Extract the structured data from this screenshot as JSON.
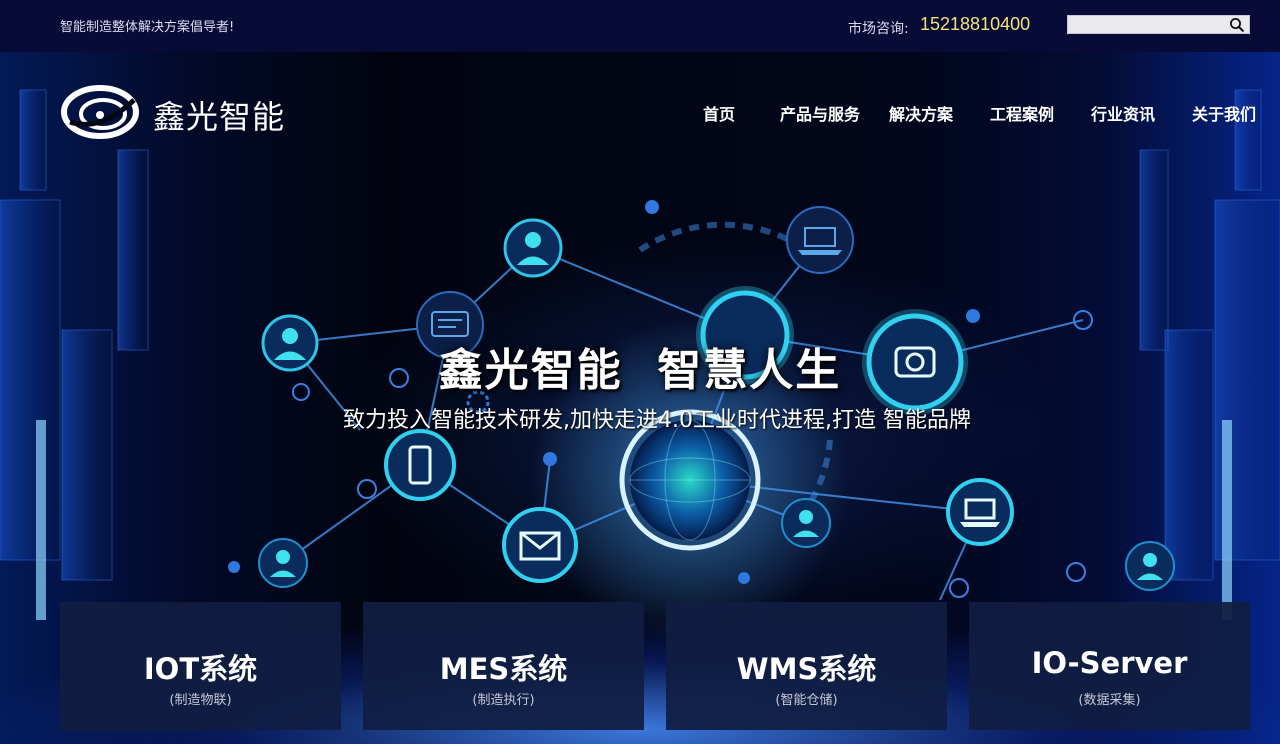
{
  "topbar": {
    "slogan": "智能制造整体解决方案倡导者!",
    "hotline_label": "市场咨询:",
    "hotline_number": "15218810400",
    "search_placeholder": ""
  },
  "header": {
    "brand": "鑫光智能",
    "nav": [
      {
        "label": "首页"
      },
      {
        "label": "产品与服务"
      },
      {
        "label": "解决方案"
      },
      {
        "label": "工程案例"
      },
      {
        "label": "行业资讯"
      },
      {
        "label": "关于我们"
      }
    ]
  },
  "hero": {
    "headline": "鑫光智能  智慧人生",
    "subline": "致力投入智能技术研发,加快走进4.0工业时代进程,打造 智能品牌"
  },
  "cards": [
    {
      "title": "IOT系统",
      "subtitle": "(制造物联)"
    },
    {
      "title": "MES系统",
      "subtitle": "(制造执行)"
    },
    {
      "title": "WMS系统",
      "subtitle": "(智能仓储)"
    },
    {
      "title": "IO-Server",
      "subtitle": "(数据采集)"
    }
  ],
  "colors": {
    "topbar_bg": "#080b36",
    "hotline": "#f3e27a",
    "card_bg": "#101e42",
    "accent_cyan": "#2fd8e8"
  }
}
